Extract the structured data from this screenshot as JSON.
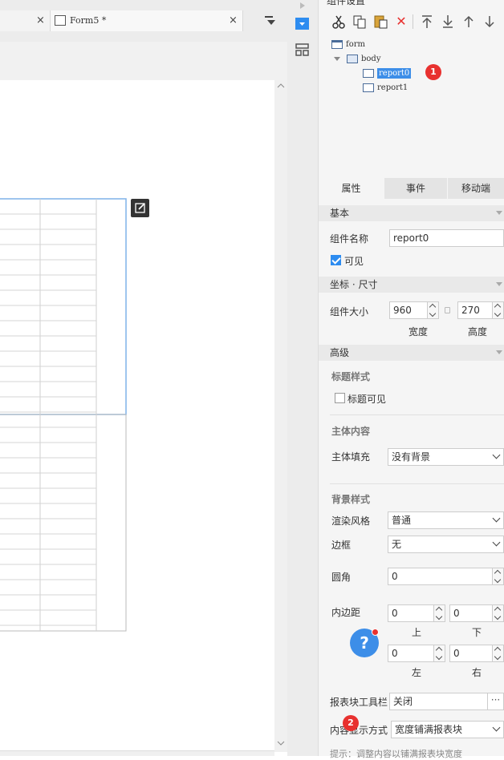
{
  "tabs": [
    {
      "label": "",
      "close": "×"
    },
    {
      "label": "Form5 *",
      "close": "×"
    }
  ],
  "panel_title": "组件设置",
  "tree": {
    "root": "form",
    "body": "body",
    "children": [
      "report0",
      "report1"
    ],
    "selected": "report0"
  },
  "annotations": {
    "badge1": "1",
    "badge2": "2",
    "help": "?"
  },
  "prop_tabs": [
    "属性",
    "事件",
    "移动端"
  ],
  "basic": {
    "header": "基本",
    "name_label": "组件名称",
    "name_value": "report0",
    "visible_label": "可见",
    "visible_checked": true
  },
  "coords": {
    "header": "坐标 · 尺寸",
    "size_label": "组件大小",
    "width_value": "960",
    "height_value": "270",
    "width_caption": "宽度",
    "height_caption": "高度"
  },
  "advanced": {
    "header": "高级",
    "title_style_label": "标题样式",
    "title_visible_label": "标题可见",
    "title_visible_checked": false,
    "main_content_label": "主体内容",
    "main_fill_label": "主体填充",
    "main_fill_value": "没有背景",
    "bg_style_label": "背景样式",
    "render_label": "渲染风格",
    "render_value": "普通",
    "border_label": "边框",
    "border_value": "无",
    "radius_label": "圆角",
    "radius_value": "0",
    "padding_label": "内边距",
    "padding": {
      "top": "0",
      "bottom": "0",
      "left": "0",
      "right": "0"
    },
    "padding_captions": {
      "top": "上",
      "bottom": "下",
      "left": "左",
      "right": "右"
    },
    "toolbar_label": "报表块工具栏",
    "toolbar_value": "关闭",
    "display_label": "内容显示方式",
    "display_value": "宽度铺满报表块",
    "hint": "提示：调整内容以铺满报表块宽度"
  },
  "colors": {
    "accent": "#2d8cf0",
    "badge": "#e8312f",
    "selection": "#3d8ee8"
  }
}
